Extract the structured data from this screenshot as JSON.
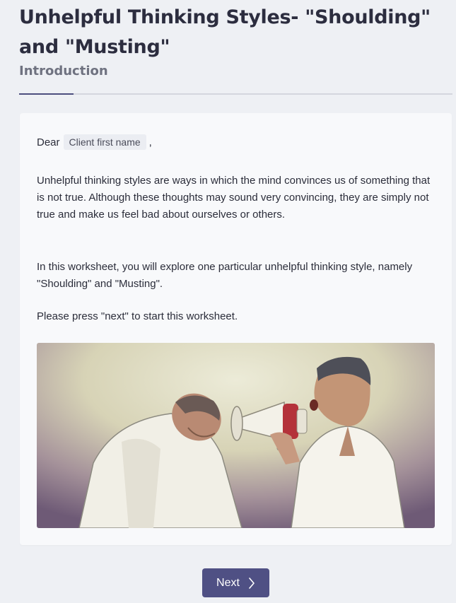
{
  "header": {
    "title": "Unhelpful Thinking Styles- \"Shoulding\" and \"Musting\"",
    "subtitle": "Introduction",
    "progress_fraction": 0.125
  },
  "content": {
    "greeting_prefix": "Dear",
    "client_name_placeholder": "Client first name",
    "greeting_suffix": ",",
    "paragraph_1": "Unhelpful thinking styles are ways in which the mind convinces us of something that is not true. Although these thoughts may sound very convincing, they are simply not true and make us feel bad about ourselves or others.",
    "paragraph_2": "In this worksheet, you will explore one particular unhelpful thinking style, namely \"Shoulding\" and \"Musting\".",
    "paragraph_3": "Please press \"next\" to start this worksheet."
  },
  "footer": {
    "next_label": "Next"
  },
  "colors": {
    "accent": "#4f5084",
    "background": "#eef0f4",
    "card": "#f8f9fb"
  }
}
